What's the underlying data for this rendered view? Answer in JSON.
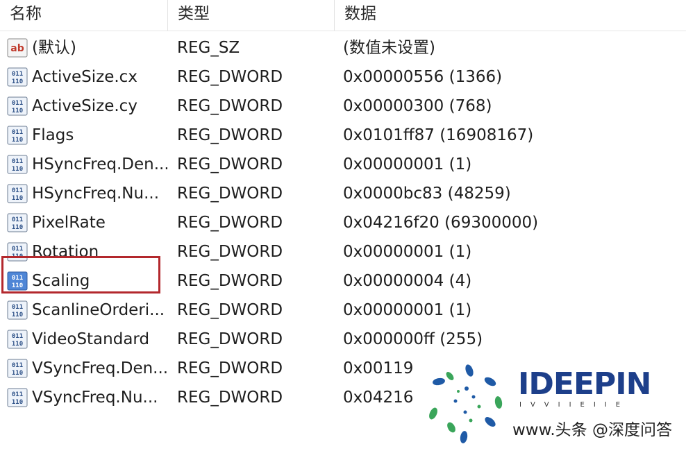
{
  "columns": {
    "name": "名称",
    "type": "类型",
    "data": "数据"
  },
  "rows": [
    {
      "icon": "reg-sz-icon",
      "name": "(默认)",
      "type": "REG_SZ",
      "data": "(数值未设置)"
    },
    {
      "icon": "reg-binary-icon",
      "name": "ActiveSize.cx",
      "type": "REG_DWORD",
      "data": "0x00000556 (1366)"
    },
    {
      "icon": "reg-binary-icon",
      "name": "ActiveSize.cy",
      "type": "REG_DWORD",
      "data": "0x00000300 (768)"
    },
    {
      "icon": "reg-binary-icon",
      "name": "Flags",
      "type": "REG_DWORD",
      "data": "0x0101ff87 (16908167)"
    },
    {
      "icon": "reg-binary-icon",
      "name": "HSyncFreq.Den...",
      "type": "REG_DWORD",
      "data": "0x00000001 (1)"
    },
    {
      "icon": "reg-binary-icon",
      "name": "HSyncFreq.Nu...",
      "type": "REG_DWORD",
      "data": "0x0000bc83 (48259)"
    },
    {
      "icon": "reg-binary-icon",
      "name": "PixelRate",
      "type": "REG_DWORD",
      "data": "0x04216f20 (69300000)"
    },
    {
      "icon": "reg-binary-icon",
      "name": "Rotation",
      "type": "REG_DWORD",
      "data": "0x00000001 (1)"
    },
    {
      "icon": "reg-binary-icon",
      "name": "Scaling",
      "type": "REG_DWORD",
      "data": "0x00000004 (4)",
      "selected": true
    },
    {
      "icon": "reg-binary-icon",
      "name": "ScanlineOrderi...",
      "type": "REG_DWORD",
      "data": "0x00000001 (1)"
    },
    {
      "icon": "reg-binary-icon",
      "name": "VideoStandard",
      "type": "REG_DWORD",
      "data": "0x000000ff (255)"
    },
    {
      "icon": "reg-binary-icon",
      "name": "VSyncFreq.Den...",
      "type": "REG_DWORD",
      "data": "0x00119"
    },
    {
      "icon": "reg-binary-icon",
      "name": "VSyncFreq.Nu...",
      "type": "REG_DWORD",
      "data": "0x04216"
    }
  ],
  "watermark": {
    "brand": "IDEEPIN",
    "strip": "IVVIIEIIE",
    "sub": "www.头条 @深度问答"
  },
  "colors": {
    "highlight_box": "#b3282d",
    "brand": "#1d3f8a",
    "logo_blue": "#1f5aa6",
    "logo_green": "#3aa55a"
  }
}
